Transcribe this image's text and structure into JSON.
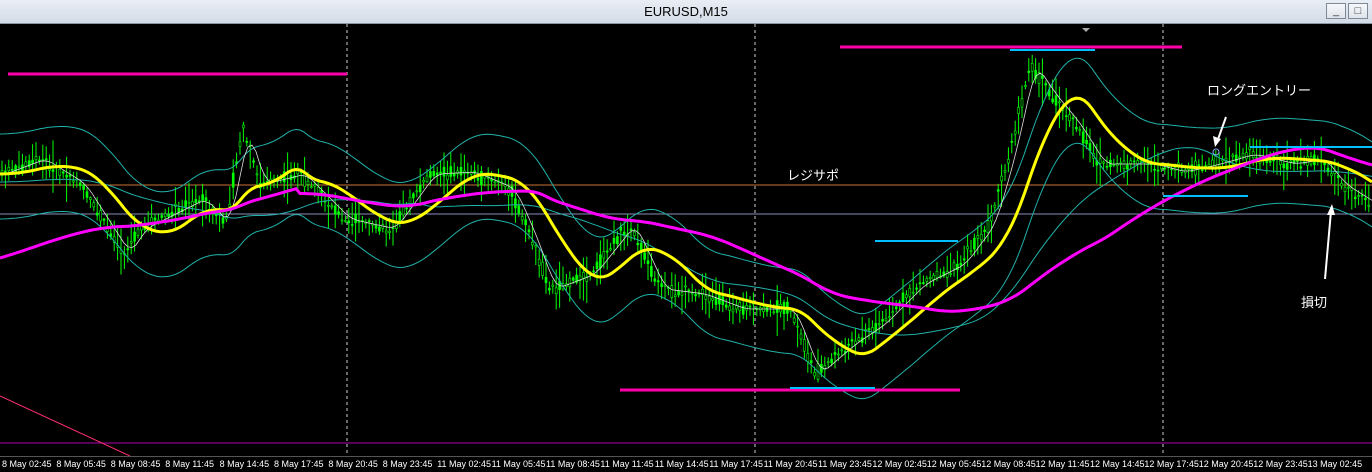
{
  "window": {
    "title": "EURUSD,M15",
    "buttons": {
      "minimize": "_",
      "maximize": "□"
    }
  },
  "annotations": {
    "long_entry": "ロングエントリー",
    "resi_sapo": "レジサポ",
    "stop_loss": "損切"
  },
  "x_axis_labels": [
    "8 May 02:45",
    "8 May 05:45",
    "8 May 08:45",
    "8 May 11:45",
    "8 May 14:45",
    "8 May 17:45",
    "8 May 20:45",
    "8 May 23:45",
    "11 May 02:45",
    "11 May 05:45",
    "11 May 08:45",
    "11 May 11:45",
    "11 May 14:45",
    "11 May 17:45",
    "11 May 20:45",
    "11 May 23:45",
    "12 May 02:45",
    "12 May 05:45",
    "12 May 08:45",
    "12 May 11:45",
    "12 May 14:45",
    "12 May 17:45",
    "12 May 20:45",
    "12 May 23:45",
    "13 May 02:45"
  ],
  "colors": {
    "candles": "#00ff00",
    "ma_fast": "#ffff00",
    "ma_slow": "#ff00ff",
    "bands": "#20b2aa",
    "level_magenta": "#ff00aa",
    "level_cyan": "#00bfff",
    "hline_orange": "#c87533",
    "hline_grey": "#8a8fb8"
  }
}
